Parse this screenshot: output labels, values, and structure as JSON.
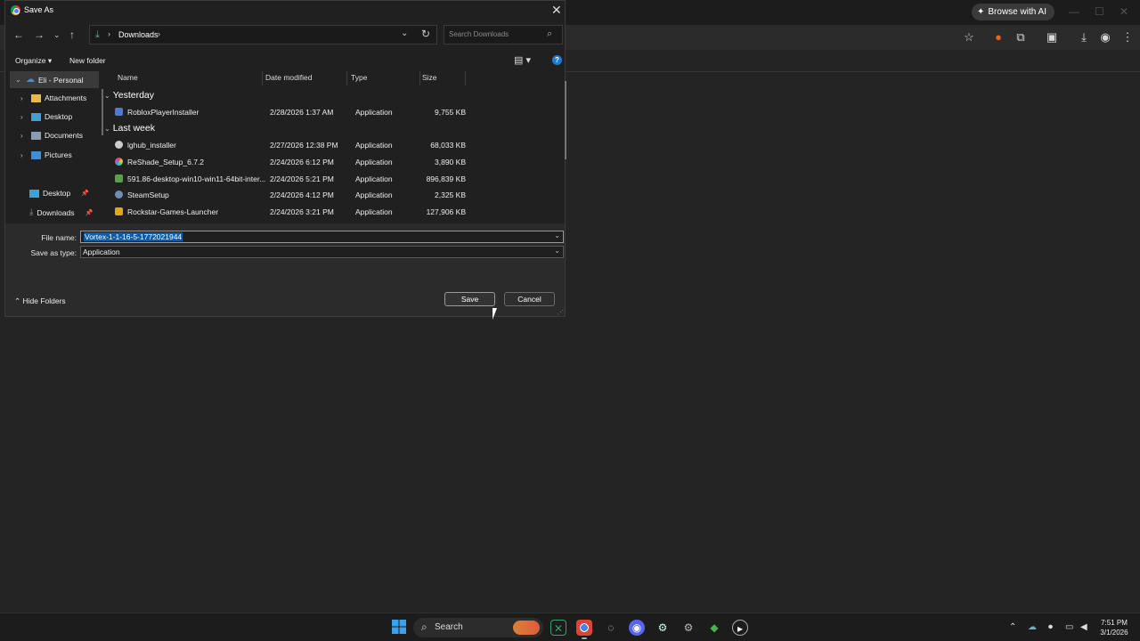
{
  "browser": {
    "browse_ai_label": "Browse with AI"
  },
  "dialog": {
    "title": "Save As",
    "address": {
      "folder": "Downloads"
    },
    "search_placeholder": "Search Downloads",
    "commands": {
      "organize": "Organize",
      "new_folder": "New folder"
    },
    "nav": [
      {
        "label": "Eli - Personal",
        "icon": "cloud-icon"
      },
      {
        "label": "Attachments",
        "icon": "folder-icon"
      },
      {
        "label": "Desktop",
        "icon": "desktop-icon"
      },
      {
        "label": "Documents",
        "icon": "documents-icon"
      },
      {
        "label": "Pictures",
        "icon": "pictures-icon"
      },
      {
        "label": "Desktop",
        "icon": "desktop-icon"
      },
      {
        "label": "Downloads",
        "icon": "download-icon"
      }
    ],
    "columns": {
      "name": "Name",
      "date": "Date modified",
      "type": "Type",
      "size": "Size"
    },
    "groups": {
      "yesterday": "Yesterday",
      "last_week": "Last week"
    },
    "files": [
      {
        "name": "RobloxPlayerInstaller",
        "date": "2/28/2026 1:37 AM",
        "type": "Application",
        "size": "9,755 KB",
        "color": "#4a7bd6"
      },
      {
        "name": "lghub_installer",
        "date": "2/27/2026 12:38 PM",
        "type": "Application",
        "size": "68,033 KB",
        "color": "#cccccc"
      },
      {
        "name": "ReShade_Setup_6.7.2",
        "date": "2/24/2026 6:12 PM",
        "type": "Application",
        "size": "3,890 KB",
        "color": "#c04ad6"
      },
      {
        "name": "591.86-desktop-win10-win11-64bit-inter...",
        "date": "2/24/2026 5:21 PM",
        "type": "Application",
        "size": "896,839 KB",
        "color": "#5aa04a"
      },
      {
        "name": "SteamSetup",
        "date": "2/24/2026 4:12 PM",
        "type": "Application",
        "size": "2,325 KB",
        "color": "#6a8fb0"
      },
      {
        "name": "Rockstar-Games-Launcher",
        "date": "2/24/2026 3:21 PM",
        "type": "Application",
        "size": "127,906 KB",
        "color": "#e8a317"
      }
    ],
    "file_name_label": "File name:",
    "file_name_value": "Vortex-1-1-16-5-1772021944",
    "save_type_label": "Save as type:",
    "save_type_value": "Application",
    "hide_folders": "Hide Folders",
    "save_button": "Save",
    "cancel_button": "Cancel"
  },
  "taskbar": {
    "search_label": "Search",
    "time": "7:51 PM",
    "date": "3/1/2026"
  }
}
